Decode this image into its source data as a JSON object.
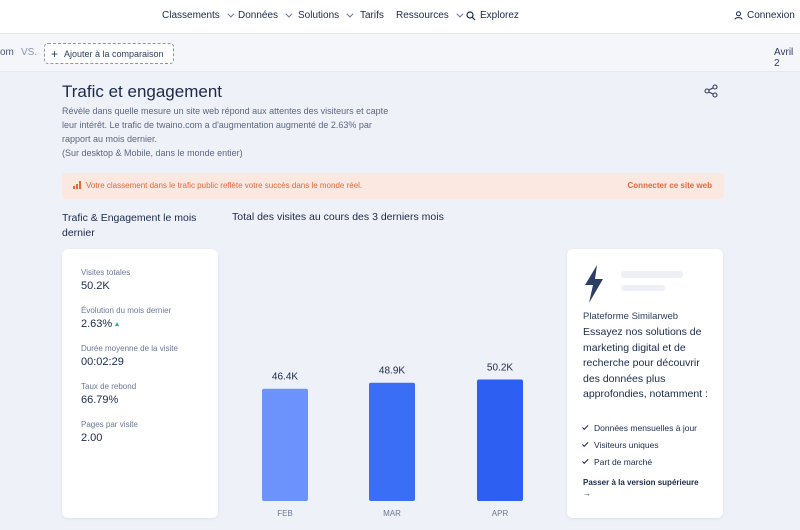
{
  "nav": {
    "items": [
      {
        "label": "Classements",
        "chevron": true
      },
      {
        "label": "Données",
        "chevron": true
      },
      {
        "label": "Solutions",
        "chevron": true
      },
      {
        "label": "Tarifs",
        "chevron": false
      },
      {
        "label": "Ressources",
        "chevron": true
      }
    ],
    "explore_label": "Explorez",
    "login_label": "Connexion"
  },
  "compare": {
    "site_fragment": "om",
    "vs_label": "VS.",
    "add_label": "Ajouter à la comparaison",
    "date_fragment": "Avril 2"
  },
  "section": {
    "title": "Trafic et engagement",
    "description": [
      "Révèle dans quelle mesure un site web répond aux attentes des visiteurs et capte",
      "leur intérêt. Le trafic de twaino.com a d'augmentation augmenté de 2.63% par",
      "rapport au mois dernier.",
      "(Sur desktop & Mobile, dans le monde entier)"
    ]
  },
  "banner": {
    "text": "Votre classement dans le trafic public reflète votre succès dans le monde réel.",
    "link": "Connecter ce site web",
    "color": "#e8663b"
  },
  "left_heading": "Trafic & Engagement le mois dernier",
  "chart_heading": "Total des visites au cours des 3 derniers mois",
  "metrics": [
    {
      "label": "Visites totales",
      "value": "50.2K"
    },
    {
      "label": "Évolution du mois dernier",
      "value": "2.63%",
      "trend": "up"
    },
    {
      "label": "Durée moyenne de la visite",
      "value": "00:02:29"
    },
    {
      "label": "Taux de rebond",
      "value": "66.79%"
    },
    {
      "label": "Pages par visite",
      "value": "2.00"
    }
  ],
  "chart_data": {
    "type": "bar",
    "title": "Total des visites au cours des 3 derniers mois",
    "categories": [
      "FEB",
      "MAR",
      "APR"
    ],
    "values": [
      46.4,
      48.9,
      50.2
    ],
    "data_labels": [
      "46.4K",
      "48.9K",
      "50.2K"
    ],
    "ylim": [
      0,
      62
    ],
    "grid": false,
    "colors": [
      "#6b93fb",
      "#3b6ef6",
      "#2d5ff3"
    ]
  },
  "promo": {
    "icon": "bolt-icon",
    "title": "Plateforme Similarweb",
    "body": "Essayez nos solutions de marketing digital et de recherche pour découvrir des données plus approfondies, notamment :",
    "features": [
      "Données mensuelles à jour",
      "Visiteurs uniques",
      "Part de marché"
    ],
    "cta": "Passer à la version supérieure →"
  }
}
